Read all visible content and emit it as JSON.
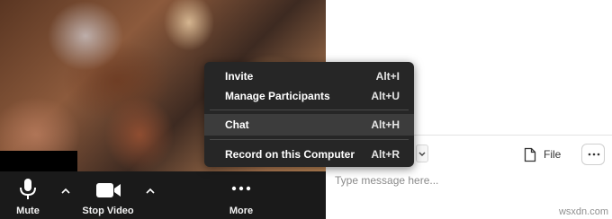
{
  "toolbar": {
    "mute_label": "Mute",
    "stop_video_label": "Stop Video",
    "more_label": "More"
  },
  "more_menu": {
    "items": [
      {
        "label": "Invite",
        "shortcut": "Alt+I",
        "highlighted": false
      },
      {
        "label": "Manage Participants",
        "shortcut": "Alt+U",
        "highlighted": false
      },
      {
        "label": "Chat",
        "shortcut": "Alt+H",
        "highlighted": true
      },
      {
        "label": "Record on this Computer",
        "shortcut": "Alt+R",
        "highlighted": false
      }
    ]
  },
  "chat": {
    "file_label": "File",
    "input_placeholder": "Type message here..."
  },
  "watermark": "wsxdn.com",
  "colors": {
    "toolbar_bg": "#1a1a1a",
    "menu_bg": "#262626",
    "menu_highlight": "#3c3c3c"
  },
  "icons": [
    "microphone-icon",
    "caret-up-icon",
    "video-camera-icon",
    "more-dots-icon",
    "caret-down-icon",
    "file-icon",
    "ellipsis-icon"
  ]
}
